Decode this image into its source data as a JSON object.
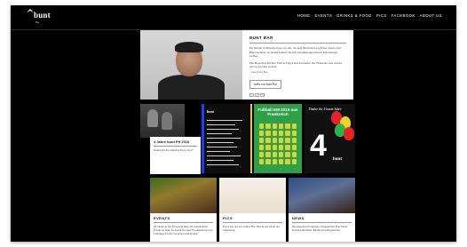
{
  "header": {
    "logo_name": "bunt",
    "logo_sub": "Bar",
    "nav": [
      "HOME",
      "EVENTS",
      "DRINKS & FOOD",
      "PICS",
      "FACEBOOK",
      "ABOUT US"
    ]
  },
  "hero": {
    "title": "BUNT BAR",
    "paragraph1": "Im bunten Schläuche liegt ein Ort, an dem Menschen jeglicher Arten und Hintergründe zu einem bunten Strauß zusammengewürfelt aufeinander treffen.",
    "paragraph2": "Die Besucher für alle Fußverfolger und Genießer. Ihr Erkunder neu setzen, das zu werden wollen.",
    "signature": "– Die bunte Bar",
    "button_label": "mehr zur bunt Bar",
    "share_labels": [
      "f",
      "t",
      "+"
    ]
  },
  "feature": {
    "title": "4 Jahre bunt FH 2016",
    "text": "Danke für die bunteste Party ever!!"
  },
  "poster1": {
    "title": "bunt"
  },
  "poster2": {
    "title": "Fußball EM 2016 aus Frankreich"
  },
  "poster3": {
    "title": "Danke für 4 bunte Jahre",
    "numeral": "4",
    "brand": "bunt",
    "balloon_colors": [
      "#e8202a",
      "#f0d22a",
      "#2bb24c",
      "#e8202a"
    ]
  },
  "cards": {
    "events": {
      "title": "EVENTS",
      "text": "Ihr findet in der Übersicht über die kommenden Events in bunt. So könnt ihr euer Freundeskreis und Lieblings-Events besuchen und planen."
    },
    "pics": {
      "title": "PICS",
      "text": "Fotos aus der der bunten Bar. Macht ein bildet der Stimmung."
    },
    "news": {
      "title": "NEWS",
      "text": "Die neuesten Ereignisse, Neuigkeiten über bunte Gästenachrichten, Musik und Allgemeines."
    }
  }
}
